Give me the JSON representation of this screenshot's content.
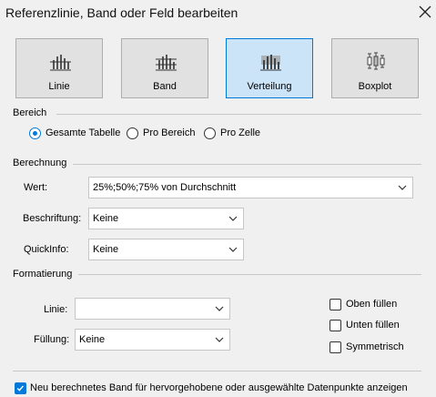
{
  "dialog": {
    "title": "Referenzlinie, Band oder Feld bearbeiten"
  },
  "type_buttons": [
    {
      "label": "Linie",
      "selected": false
    },
    {
      "label": "Band",
      "selected": false
    },
    {
      "label": "Verteilung",
      "selected": true
    },
    {
      "label": "Boxplot",
      "selected": false
    }
  ],
  "bereich": {
    "heading": "Bereich",
    "options": [
      {
        "label": "Gesamte Tabelle",
        "checked": true
      },
      {
        "label": "Pro Bereich",
        "checked": false
      },
      {
        "label": "Pro Zelle",
        "checked": false
      }
    ]
  },
  "berechnung": {
    "heading": "Berechnung",
    "wert": {
      "label": "Wert:",
      "value": "25%;50%;75% von Durchschnitt"
    },
    "beschriftung": {
      "label": "Beschriftung:",
      "value": "Keine"
    },
    "quickinfo": {
      "label": "QuickInfo:",
      "value": "Keine"
    }
  },
  "formatierung": {
    "heading": "Formatierung",
    "linie": {
      "label": "Linie:",
      "value": ""
    },
    "fuellung": {
      "label": "Füllung:",
      "value": "Keine"
    },
    "checkboxes": [
      {
        "label": "Oben füllen",
        "checked": false
      },
      {
        "label": "Unten füllen",
        "checked": false
      },
      {
        "label": "Symmetrisch",
        "checked": false
      }
    ]
  },
  "footer": {
    "checkbox_label": "Neu berechnetes Band für hervorgehobene oder ausgewählte Datenpunkte anzeigen",
    "checked": true
  },
  "colors": {
    "accent": "#0078d7",
    "selected_bg": "#cce4f7",
    "button_bg": "#e1e1e1"
  }
}
